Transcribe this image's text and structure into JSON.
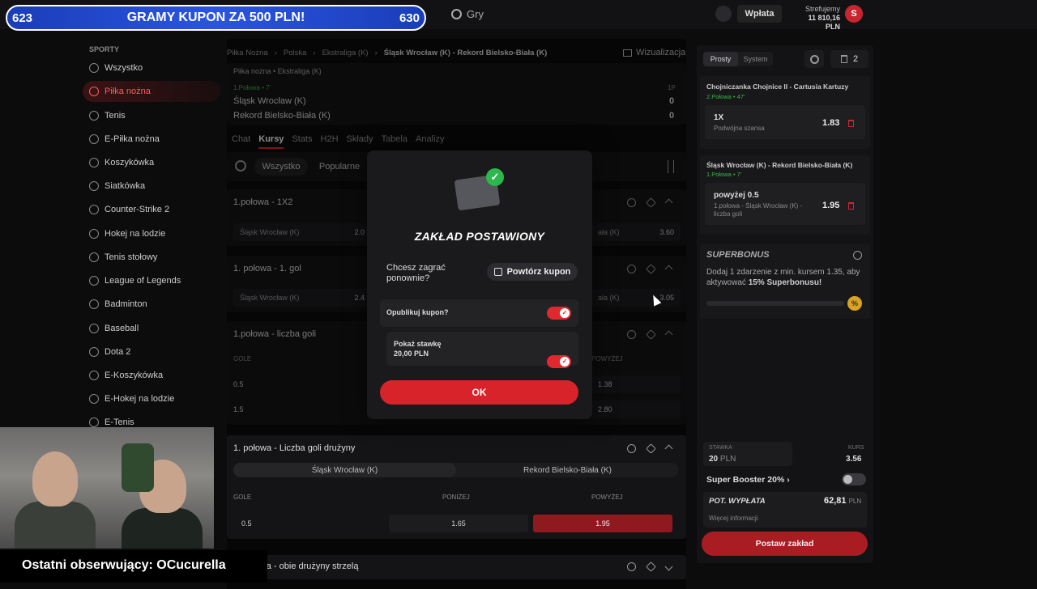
{
  "banner": {
    "left_num": "623",
    "title": "GRAMY KUPON ZA 500 PLN!",
    "right_num": "630"
  },
  "topbar": {
    "games": "Gry",
    "deposit": "Wpłata",
    "account_name": "Strefujemy",
    "balance": "11 810,16 PLN",
    "avatar": "S"
  },
  "sidebar": {
    "heading": "SPORTY",
    "items": [
      {
        "label": "Wszystko",
        "icon": "chart-icon"
      },
      {
        "label": "Piłka nożna",
        "icon": "soccer-ball-icon",
        "active": true
      },
      {
        "label": "Tenis",
        "icon": "tennis-ball-icon"
      },
      {
        "label": "E-Piłka nożna",
        "icon": "esoccer-icon"
      },
      {
        "label": "Koszykówka",
        "icon": "basketball-icon"
      },
      {
        "label": "Siatkówka",
        "icon": "volleyball-icon"
      },
      {
        "label": "Counter-Strike 2",
        "icon": "cs2-icon"
      },
      {
        "label": "Hokej na lodzie",
        "icon": "hockey-icon"
      },
      {
        "label": "Tenis stołowy",
        "icon": "table-tennis-icon"
      },
      {
        "label": "League of Legends",
        "icon": "lol-icon"
      },
      {
        "label": "Badminton",
        "icon": "badminton-icon"
      },
      {
        "label": "Baseball",
        "icon": "baseball-icon"
      },
      {
        "label": "Dota 2",
        "icon": "dota-icon"
      },
      {
        "label": "E-Koszykówka",
        "icon": "ebasketball-icon"
      },
      {
        "label": "E-Hokej na lodzie",
        "icon": "ehockey-icon"
      },
      {
        "label": "E-Tenis",
        "icon": "etennis-icon"
      }
    ]
  },
  "breadcrumb": {
    "sport": "Piłka Nożna",
    "country": "Polska",
    "league": "Ekstraliga (K)",
    "match": "Śląsk Wrocław (K) - Rekord Bielsko-Biała (K)"
  },
  "visualization": "Wizualizacja",
  "match": {
    "league_label": "Piłka nożna • Ekstraliga (K)",
    "phase": "1.Połowa • 7'",
    "period": "1P",
    "home": "Śląsk Wrocław (K)",
    "away": "Rekord Bielsko-Biała (K)",
    "home_score": "0",
    "away_score": "0"
  },
  "tabs": [
    "Chat",
    "Kursy",
    "Stats",
    "H2H",
    "Składy",
    "Tabela",
    "Analizy"
  ],
  "filters": {
    "all": "Wszystko",
    "popular": "Popularne"
  },
  "markets": {
    "m1": {
      "title": "1.połowa - 1X2",
      "left_team": "Śląsk Wrocław (K)",
      "left_odd": "2.0",
      "right_label": "ała (K)",
      "right_odd": "3.60"
    },
    "m2": {
      "title": "1. połowa - 1. gol",
      "left_team": "Śląsk Wrocław (K)",
      "left_odd": "2.4",
      "right_label": "ała (K)",
      "right_odd": "3.05"
    },
    "m3": {
      "title": "1.połowa - liczba goli",
      "col_goals": "GOLE",
      "col_over": "POWYŻEJ",
      "rows": [
        {
          "line": "0.5",
          "over": "1.38"
        },
        {
          "line": "1.5",
          "over": "2.80"
        }
      ]
    },
    "m4": {
      "title": "1. połowa - Liczba goli drużyny",
      "team_a": "Śląsk Wrocław (K)",
      "team_b": "Rekord Bielsko-Biała (K)",
      "col_goals": "GOLE",
      "col_under": "PONIŻEJ",
      "col_over": "POWYŻEJ",
      "line": "0.5",
      "under": "1.65",
      "over": "1.95"
    },
    "m5": {
      "title": "połowa - obie drużyny strzelą"
    }
  },
  "modal": {
    "title": "ZAKŁAD POSTAWIONY",
    "question": "Chcesz zagrać ponownie?",
    "repeat": "Powtórz kupon",
    "publish": "Opublikuj kupon?",
    "show_stake": "Pokaż stawkę",
    "stake_value": "20,00 PLN",
    "ok": "OK"
  },
  "betslip": {
    "tab_single": "Prosty",
    "tab_system": "System",
    "count": "2",
    "bet1": {
      "event": "Chojniczanka Chojnice II - Cartusia Kartuzy",
      "phase": "2.Połowa • 47'",
      "pick": "1X",
      "desc": "Podwójna szansa",
      "odd": "1.83"
    },
    "bet2": {
      "event": "Śląsk Wrocław (K) - Rekord Bielsko-Biała (K)",
      "phase": "1.Połowa • 7'",
      "pick": "powyżej 0.5",
      "desc": "1.połowa - Śląsk Wrocław (K) - liczba goli",
      "odd": "1.95"
    },
    "superbonus_title": "SUPERBONUS",
    "superbonus_text_1": "Dodaj 1 zdarzenie z min. kursem 1.35, aby aktywować",
    "superbonus_text_bold": "15% Superbonusu!",
    "superbonus_badge": "%",
    "stake_label": "STAWKA",
    "stake_value": "20",
    "stake_currency": "PLN",
    "odds_label": "KURS",
    "odds_value": "3.56",
    "booster": "Super Booster 20%",
    "payout_label": "POT. WYPŁATA",
    "payout_value": "62,81",
    "payout_currency": "PLN",
    "more_info": "Więcej informacji",
    "place_bet": "Postaw zakład"
  },
  "footer": {
    "last_follower": "Ostatni obserwujący: OCucurella"
  },
  "colors": {
    "accent": "#e0282f",
    "banner_blue": "#2b55e0",
    "live_green": "#39b54a",
    "gold": "#d9a323"
  }
}
